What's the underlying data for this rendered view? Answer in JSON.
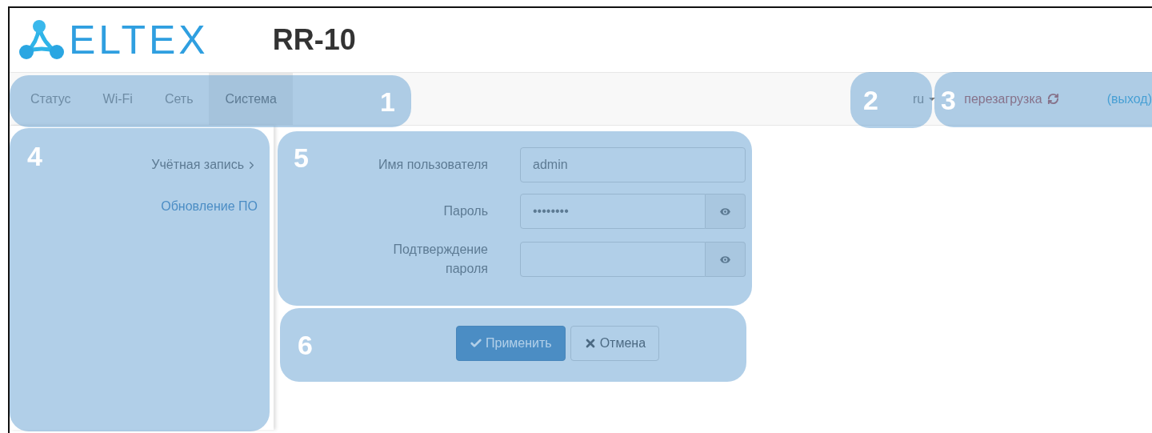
{
  "logo": {
    "text": "ELTEX"
  },
  "model": "RR-10",
  "nav": {
    "tabs": [
      {
        "label": "Статус",
        "selected": false
      },
      {
        "label": "Wi-Fi",
        "selected": false
      },
      {
        "label": "Сеть",
        "selected": false
      },
      {
        "label": "Система",
        "selected": true
      }
    ],
    "language": "ru",
    "reboot": "перезагрузка",
    "logout": "(выход)"
  },
  "sidebar": {
    "items": [
      {
        "label": "Учётная запись",
        "selected": true
      },
      {
        "label": "Обновление ПО",
        "selected": false
      }
    ]
  },
  "form": {
    "fields": [
      {
        "label": "Имя пользователя",
        "kind": "text",
        "value": "admin"
      },
      {
        "label": "Пароль",
        "kind": "password",
        "value": "••••••••"
      },
      {
        "label": "Подтверждение пароля",
        "kind": "password"
      }
    ]
  },
  "buttons": [
    {
      "label": "Применить",
      "kind": "primary"
    },
    {
      "label": "Отмена",
      "kind": "cancel"
    }
  ],
  "annotations": [
    {
      "number": "1"
    },
    {
      "number": "2"
    },
    {
      "number": "3"
    },
    {
      "number": "4"
    },
    {
      "number": "5"
    },
    {
      "number": "6"
    }
  ]
}
